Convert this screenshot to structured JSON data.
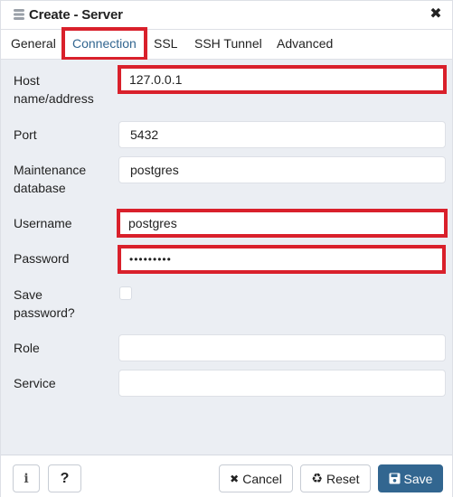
{
  "dialog": {
    "title": "Create - Server",
    "title_icon": "server-icon",
    "close_icon": "close-icon",
    "close_glyph": "✖"
  },
  "tabs": [
    {
      "label": "General",
      "active": false
    },
    {
      "label": "Connection",
      "active": true
    },
    {
      "label": "SSL",
      "active": false
    },
    {
      "label": "SSH Tunnel",
      "active": false
    },
    {
      "label": "Advanced",
      "active": false
    }
  ],
  "form": {
    "host": {
      "label_line1": "Host",
      "label_line2": "name/address",
      "value": "127.0.0.1",
      "highlighted": true
    },
    "port": {
      "label": "Port",
      "value": "5432"
    },
    "maintenance_db": {
      "label_line1": "Maintenance",
      "label_line2": "database",
      "value": "postgres"
    },
    "username": {
      "label": "Username",
      "value": "postgres",
      "highlighted": true
    },
    "password": {
      "label": "Password",
      "value": "•••••••••",
      "highlighted": true
    },
    "save_password": {
      "label_line1": "Save",
      "label_line2": "password?",
      "checked": false
    },
    "role": {
      "label": "Role",
      "value": ""
    },
    "service": {
      "label": "Service",
      "value": ""
    }
  },
  "footer": {
    "info_glyph": "i",
    "help_glyph": "?",
    "cancel": {
      "icon": "✖",
      "label": "Cancel"
    },
    "reset": {
      "icon": "♻",
      "label": "Reset"
    },
    "save": {
      "icon": "💾",
      "label": "Save"
    }
  },
  "colors": {
    "accent": "#326690",
    "highlight": "#d9202b",
    "body_bg": "#ebeef3"
  }
}
